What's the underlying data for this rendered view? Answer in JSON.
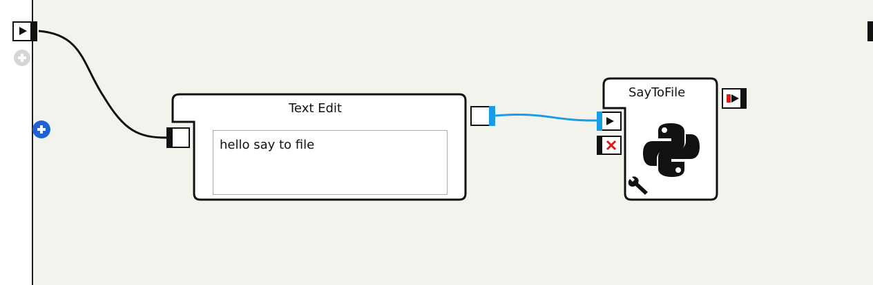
{
  "nodes": {
    "text_edit": {
      "title": "Text Edit",
      "content": "hello say to file"
    },
    "say_to_file": {
      "title": "SayToFile",
      "icon": "python-logo-icon",
      "settings_icon": "wrench-icon"
    }
  },
  "colors": {
    "canvas": "#f3f3ee",
    "wire_control": "#111111",
    "wire_data": "#1a9be6",
    "add_button_active": "#1e62d6",
    "add_button_inactive": "#d6d6d6",
    "error_red": "#e01818"
  },
  "icons": {
    "graph_input_port": "play-icon",
    "add_inactive": "plus-circle-icon",
    "add_active": "plus-circle-icon",
    "exec_out": "play-icon",
    "fail": "close-icon",
    "stop_out": "stop-play-icon"
  }
}
